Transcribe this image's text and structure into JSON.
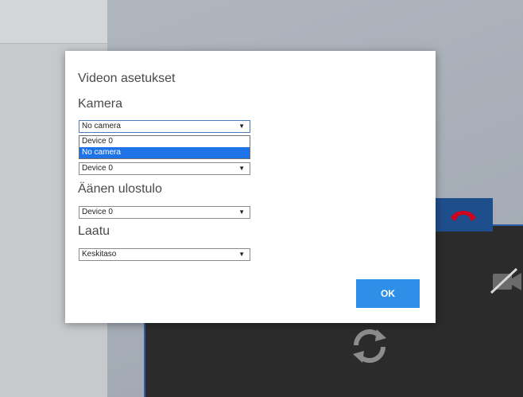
{
  "dialog": {
    "title": "Videon asetukset",
    "camera": {
      "label": "Kamera",
      "value": "No camera",
      "options": [
        "Device 0",
        "No camera"
      ]
    },
    "microphone": {
      "value": "Device 0"
    },
    "audio_output": {
      "label": "Äänen ulostulo",
      "value": "Device 0"
    },
    "quality": {
      "label": "Laatu",
      "value": "Keskitaso"
    },
    "ok_label": "OK"
  },
  "icons": {
    "dropdown_arrow": "▼",
    "hangup": "phone-hangup-icon",
    "camera_off": "camera-off-icon",
    "refresh": "refresh-icon"
  },
  "colors": {
    "ok_button": "#2d8fe8",
    "highlight": "#1e73e8",
    "hangup_icon": "#d0021b",
    "hangup_bg": "#1f4e8c"
  }
}
